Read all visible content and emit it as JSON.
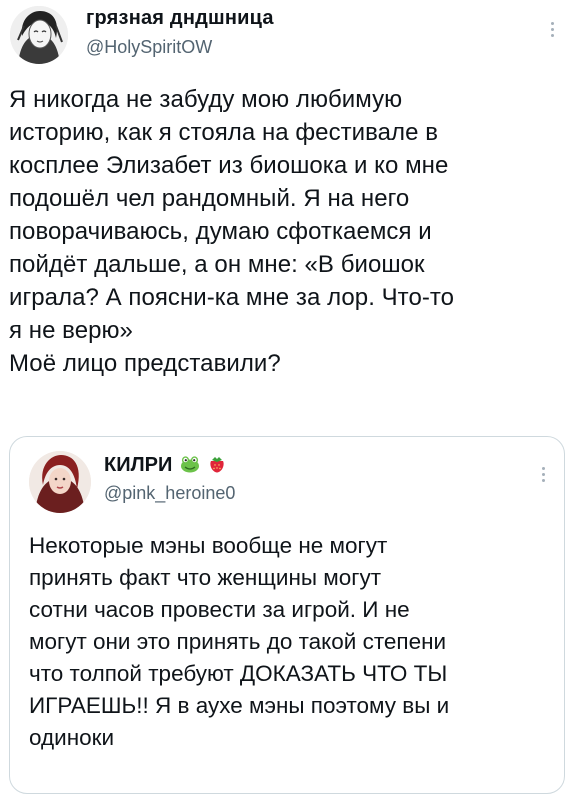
{
  "tweet": {
    "author_name": "грязная дндшница",
    "author_handle": "@HolySpiritOW",
    "text": "Я никогда не забуду мою любимую\nисторию, как я стояла на фестивале в\nкосплее Элизабет из биошока и ко мне\nподошёл чел рандомный. Я на него\nповорачиваюсь, думаю сфоткаемся и\nпойдёт дальше, а он мне: «В биошок\nиграла? А поясни-ка мне за лор. Что-то\nя не верю»\nМоё лицо представили?",
    "more_icon": "more-vertical-icon"
  },
  "quoted_tweet": {
    "author_name": "КИЛРИ",
    "author_emojis": [
      "frog-icon",
      "strawberry-icon"
    ],
    "author_handle": "@pink_heroine0",
    "text": "Некоторые мэны вообще не могут\nпринять факт что женщины могут\nсотни часов провести за игрой. И не\nмогут они это принять до такой степени\nчто толпой требуют ДОКАЗАТЬ ЧТО ТЫ\nИГРАЕШЬ!! Я в аухе мэны поэтому вы и\nодиноки",
    "more_icon": "more-vertical-icon"
  },
  "colors": {
    "text": "#0f1419",
    "secondary": "#536471",
    "border": "#cfd9de",
    "background": "#ffffff"
  }
}
